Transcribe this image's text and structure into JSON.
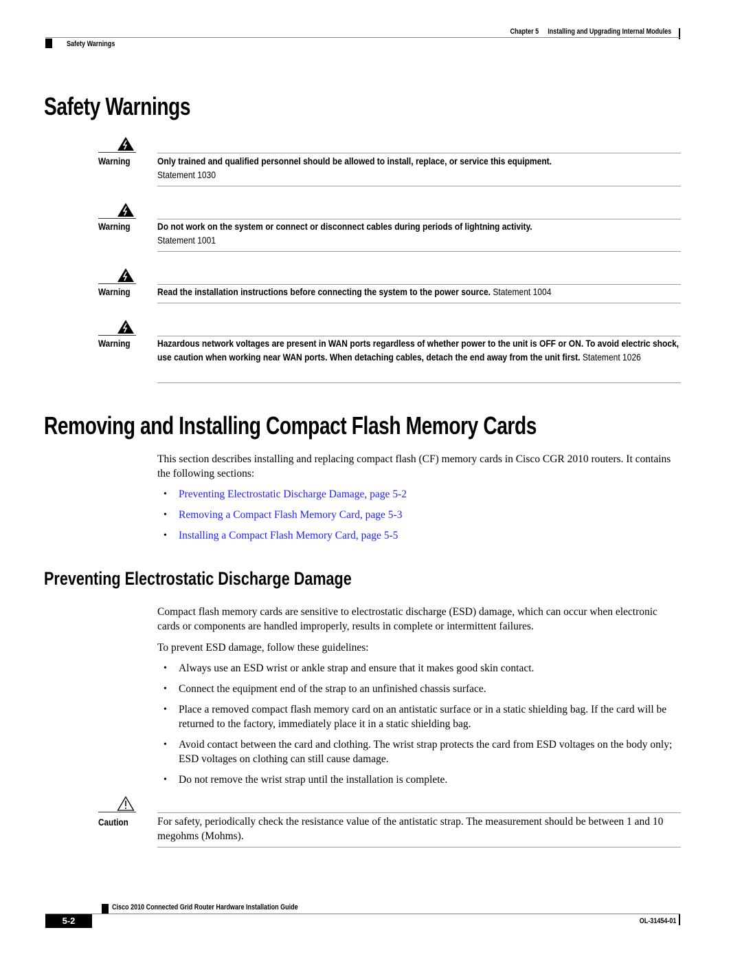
{
  "header": {
    "chapter_label": "Chapter 5",
    "chapter_title": "Installing and Upgrading Internal Modules",
    "section": "Safety Warnings"
  },
  "safety": {
    "heading": "Safety Warnings",
    "warnings": [
      {
        "label": "Warning",
        "icon": "warning-electric-icon",
        "text_bold": "Only trained and qualified personnel should be allowed to install, replace, or service this equipment.",
        "statement": "Statement 1030"
      },
      {
        "label": "Warning",
        "icon": "warning-electric-icon",
        "text_bold": "Do not work on the system or connect or disconnect cables during periods of lightning activity.",
        "statement": "Statement 1001"
      },
      {
        "label": "Warning",
        "icon": "warning-electric-icon",
        "text_bold": "Read the installation instructions before connecting the system to the power source.",
        "statement": "Statement 1004"
      },
      {
        "label": "Warning",
        "icon": "warning-electric-icon",
        "text_bold": "Hazardous network voltages are present in WAN ports regardless of whether power to the unit is OFF or ON. To avoid electric shock, use caution when working near WAN ports. When detaching cables, detach the end away from the unit first.",
        "statement": "Statement 1026"
      }
    ]
  },
  "cf_section": {
    "heading": "Removing and Installing Compact Flash Memory Cards",
    "intro": "This section describes installing and replacing compact flash (CF) memory cards in Cisco CGR 2010 routers. It contains the following sections:",
    "links": [
      "Preventing Electrostatic Discharge Damage, page 5-2",
      "Removing a Compact Flash Memory Card, page 5-3",
      "Installing a Compact Flash Memory Card, page 5-5"
    ],
    "link_color": "#1f1fff"
  },
  "esd_section": {
    "heading": "Preventing Electrostatic Discharge Damage",
    "para1": "Compact flash memory cards are sensitive to electrostatic discharge (ESD) damage, which can occur when electronic cards or components are handled improperly, results in complete or intermittent failures.",
    "para2": "To prevent ESD damage, follow these guidelines:",
    "bullets": [
      "Always use an ESD wrist or ankle strap and ensure that it makes good skin contact.",
      "Connect the equipment end of the strap to an unfinished chassis surface.",
      "Place a removed compact flash memory card on an antistatic surface or in a static shielding bag. If the card will be returned to the factory, immediately place it in a static shielding bag.",
      "Avoid contact between the card and clothing. The wrist strap protects the card from ESD voltages on the body only; ESD voltages on clothing can still cause damage.",
      "Do not remove the wrist strap until the installation is complete."
    ],
    "caution": {
      "label": "Caution",
      "icon": "caution-triangle-icon",
      "text": "For safety, periodically check the resistance value of the antistatic strap. The measurement should be between 1 and 10 megohms (Mohms)."
    }
  },
  "footer": {
    "guide_title": "Cisco 2010 Connected Grid Router Hardware Installation Guide",
    "page_number": "5-2",
    "doc_id": "OL-31454-01"
  },
  "bullet_glyph": "•"
}
